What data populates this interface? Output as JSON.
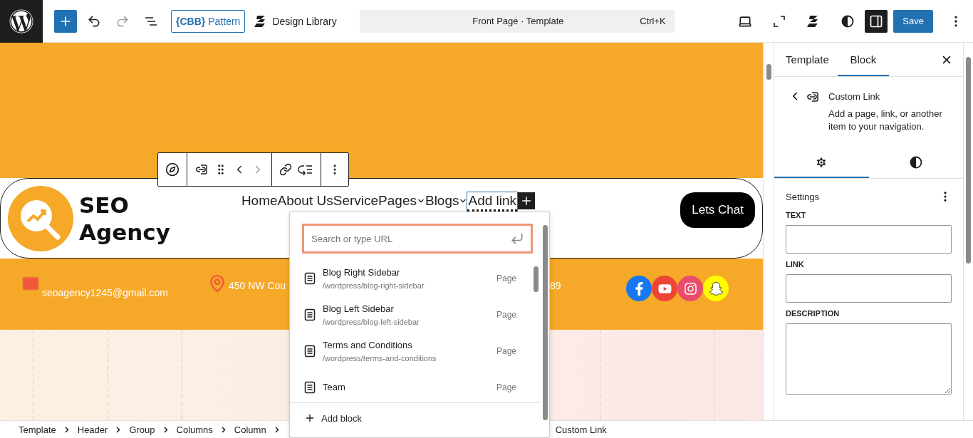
{
  "toolbar": {
    "undo": {
      "disabled": false
    },
    "redo": {
      "disabled": true
    },
    "pattern": {
      "brand": "{CBB}",
      "label": "Pattern"
    },
    "design_library": "Design Library",
    "command": {
      "title": "Front Page · Template",
      "shortcut": "Ctrl+K"
    },
    "sidebar_toggle": {
      "pressed": true
    },
    "save": "Save"
  },
  "site": {
    "logo": {
      "line1": "SEO",
      "line2": "Agency"
    },
    "nav": [
      {
        "label": "Home",
        "submenu": false,
        "selected": false
      },
      {
        "label": "About Us",
        "submenu": false,
        "selected": false
      },
      {
        "label": "Service",
        "submenu": false,
        "selected": false
      },
      {
        "label": "Pages",
        "submenu": true,
        "selected": false
      },
      {
        "label": "Blogs",
        "submenu": true,
        "selected": false
      },
      {
        "label": "Add link",
        "submenu": false,
        "selected": true
      }
    ],
    "cta": "Lets Chat",
    "contact": [
      {
        "kind": "email",
        "text": "seoagency1245@gmail.com"
      },
      {
        "kind": "address",
        "text": "450 NW Cou"
      },
      {
        "kind": "phone",
        "text": "89"
      }
    ],
    "socials": [
      {
        "kind": "facebook"
      },
      {
        "kind": "youtube"
      },
      {
        "kind": "instagram"
      },
      {
        "kind": "snapchat"
      }
    ]
  },
  "link_popover": {
    "search": {
      "placeholder": "Search or type URL"
    },
    "results": [
      {
        "title": "Blog Right Sidebar",
        "url": "/wordpress/blog-right-sidebar",
        "type": "Page"
      },
      {
        "title": "Blog Left Sidebar",
        "url": "/wordpress/blog-left-sidebar",
        "type": "Page"
      },
      {
        "title": "Terms and Conditions",
        "url": "/wordpress/terms-and-conditions",
        "type": "Page"
      },
      {
        "title": "Team",
        "type": "Page"
      }
    ],
    "add_block": "Add block"
  },
  "breadcrumbs": [
    "Template",
    "Header",
    "Group",
    "Columns",
    "Column"
  ],
  "breadcrumb_current": "Custom Link",
  "sidebar": {
    "tabs": [
      {
        "label": "Template",
        "selected": false
      },
      {
        "label": "Block",
        "selected": true
      }
    ],
    "block": {
      "title": "Custom Link",
      "description": "Add a page, link, or another item to your navigation."
    },
    "subtabs": [
      {
        "kind": "settings",
        "selected": true
      },
      {
        "kind": "styles",
        "selected": false
      }
    ],
    "section": "Settings",
    "fields": [
      {
        "label": "TEXT",
        "kind": "input"
      },
      {
        "label": "LINK",
        "kind": "input"
      },
      {
        "label": "DESCRIPTION",
        "kind": "textarea"
      }
    ]
  }
}
